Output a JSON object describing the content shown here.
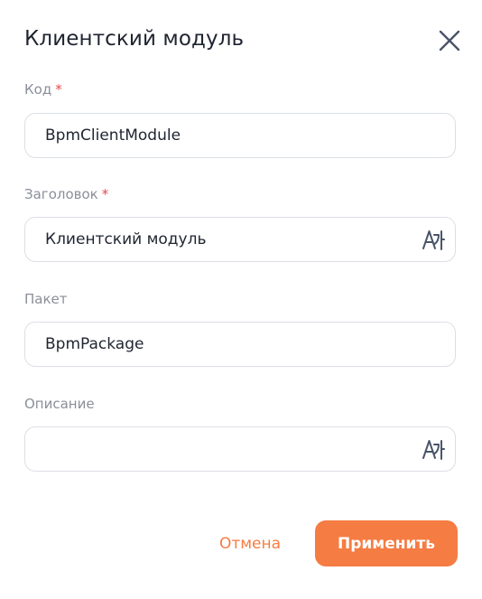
{
  "dialog": {
    "title": "Клиентский модуль",
    "close_icon": "close-icon"
  },
  "fields": {
    "code": {
      "label": "Код",
      "required_mark": "*",
      "value": "BpmClientModule"
    },
    "caption": {
      "label": "Заголовок",
      "required_mark": "*",
      "value": "Клиентский модуль",
      "action_icon": "translate-icon"
    },
    "package": {
      "label": "Пакет",
      "value": "BpmPackage"
    },
    "description": {
      "label": "Описание",
      "value": "",
      "action_icon": "translate-icon"
    }
  },
  "footer": {
    "cancel_label": "Отмена",
    "apply_label": "Применить"
  },
  "colors": {
    "accent": "#f57c43",
    "required": "#e5484d",
    "label": "#8a8f99",
    "border": "#dcdfe5",
    "text": "#1f2430"
  }
}
